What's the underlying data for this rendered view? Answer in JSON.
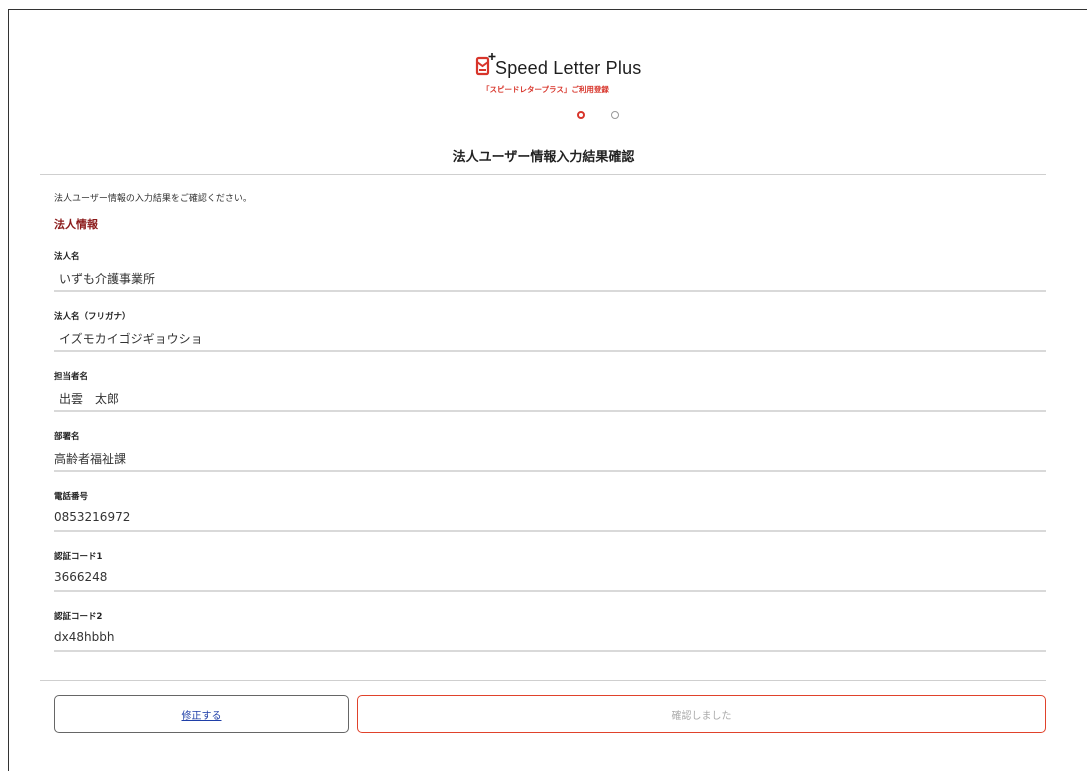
{
  "header": {
    "logo_text": "Speed Letter Plus",
    "logo_subtitle": "「スピードレタープラス」ご利用登録",
    "steps": {
      "current": 1,
      "total": 2
    },
    "title": "法人ユーザー情報入力結果確認"
  },
  "intro": "法人ユーザー情報の入力結果をご確認ください。",
  "section_title": "法人情報",
  "fields": [
    {
      "label": "法人名",
      "value": "いずも介護事業所"
    },
    {
      "label": "法人名（フリガナ）",
      "value": "イズモカイゴジギョウショ"
    },
    {
      "label": "担当者名",
      "value": "出雲　太郎"
    },
    {
      "label": "部署名",
      "value": "高齢者福祉課"
    },
    {
      "label": "電話番号",
      "value": "0853216972"
    },
    {
      "label": "認証コード1",
      "value": "3666248"
    },
    {
      "label": "認証コード2",
      "value": "dx48hbbh"
    }
  ],
  "buttons": {
    "edit_label": "修正する",
    "confirm_label": "確認しました"
  },
  "colors": {
    "accent": "#d8352b",
    "section_title": "#8b1a1a",
    "link": "#1f3fa8"
  },
  "icons": {
    "logo": "mail-plus-icon"
  }
}
